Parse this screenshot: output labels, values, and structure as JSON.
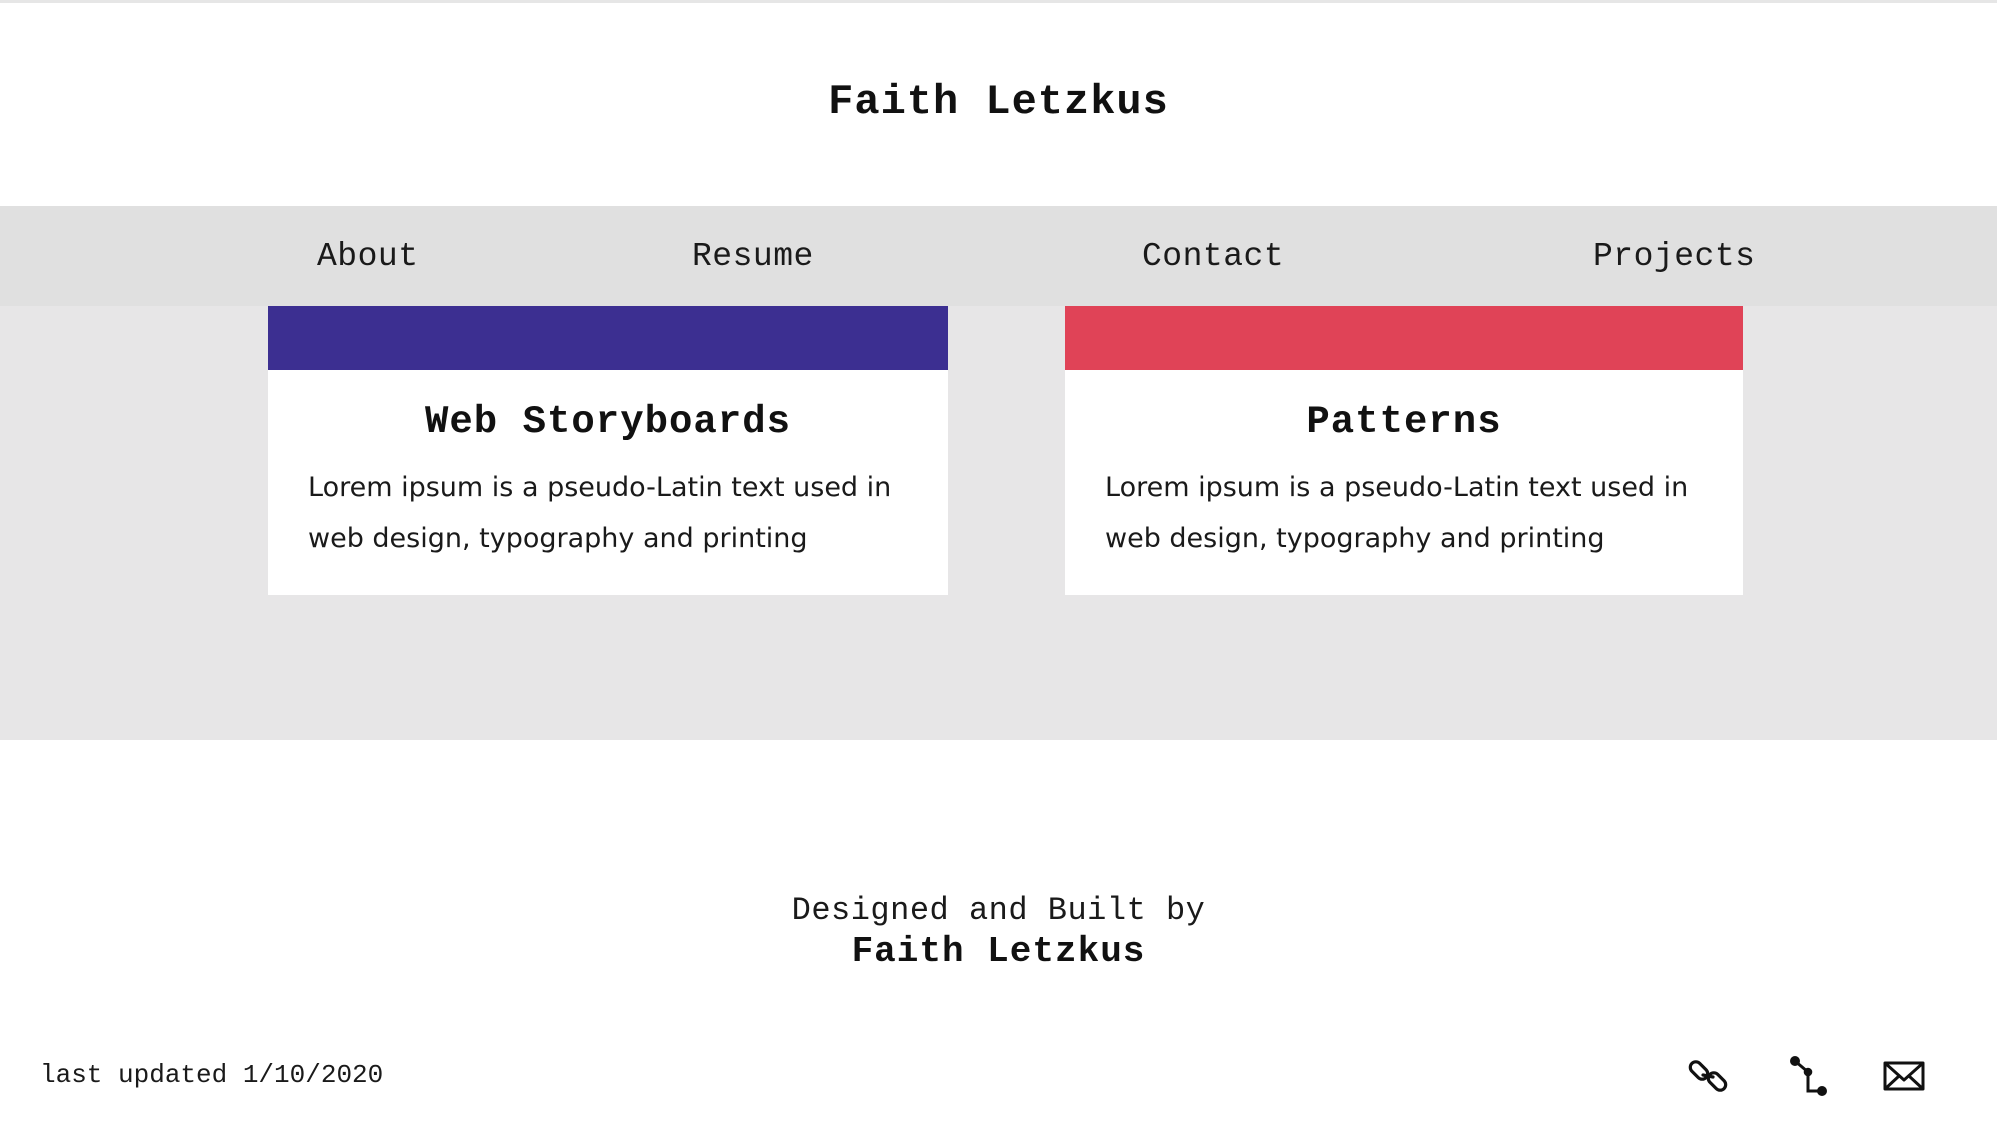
{
  "header": {
    "title": "Faith Letzkus"
  },
  "nav": {
    "items": [
      {
        "label": "About"
      },
      {
        "label": "Resume"
      },
      {
        "label": "Contact"
      },
      {
        "label": "Projects"
      }
    ]
  },
  "projects": [
    {
      "title": "Web Storyboards",
      "description": "Lorem ipsum is a pseudo-Latin text used in web design, typography and printing",
      "accent_color": "#3c2f91"
    },
    {
      "title": "Patterns",
      "description": "Lorem ipsum is a pseudo-Latin text used in web design, typography and printing",
      "accent_color": "#e04357"
    }
  ],
  "footer": {
    "credit_line": "Designed and Built by",
    "credit_name": "Faith Letzkus",
    "last_updated": "last updated 1/10/2020",
    "icons": [
      "link-icon",
      "git-icon",
      "mail-icon"
    ]
  },
  "colors": {
    "navbar_bg": "#e0e0e0",
    "content_bg": "#e7e6e7"
  }
}
